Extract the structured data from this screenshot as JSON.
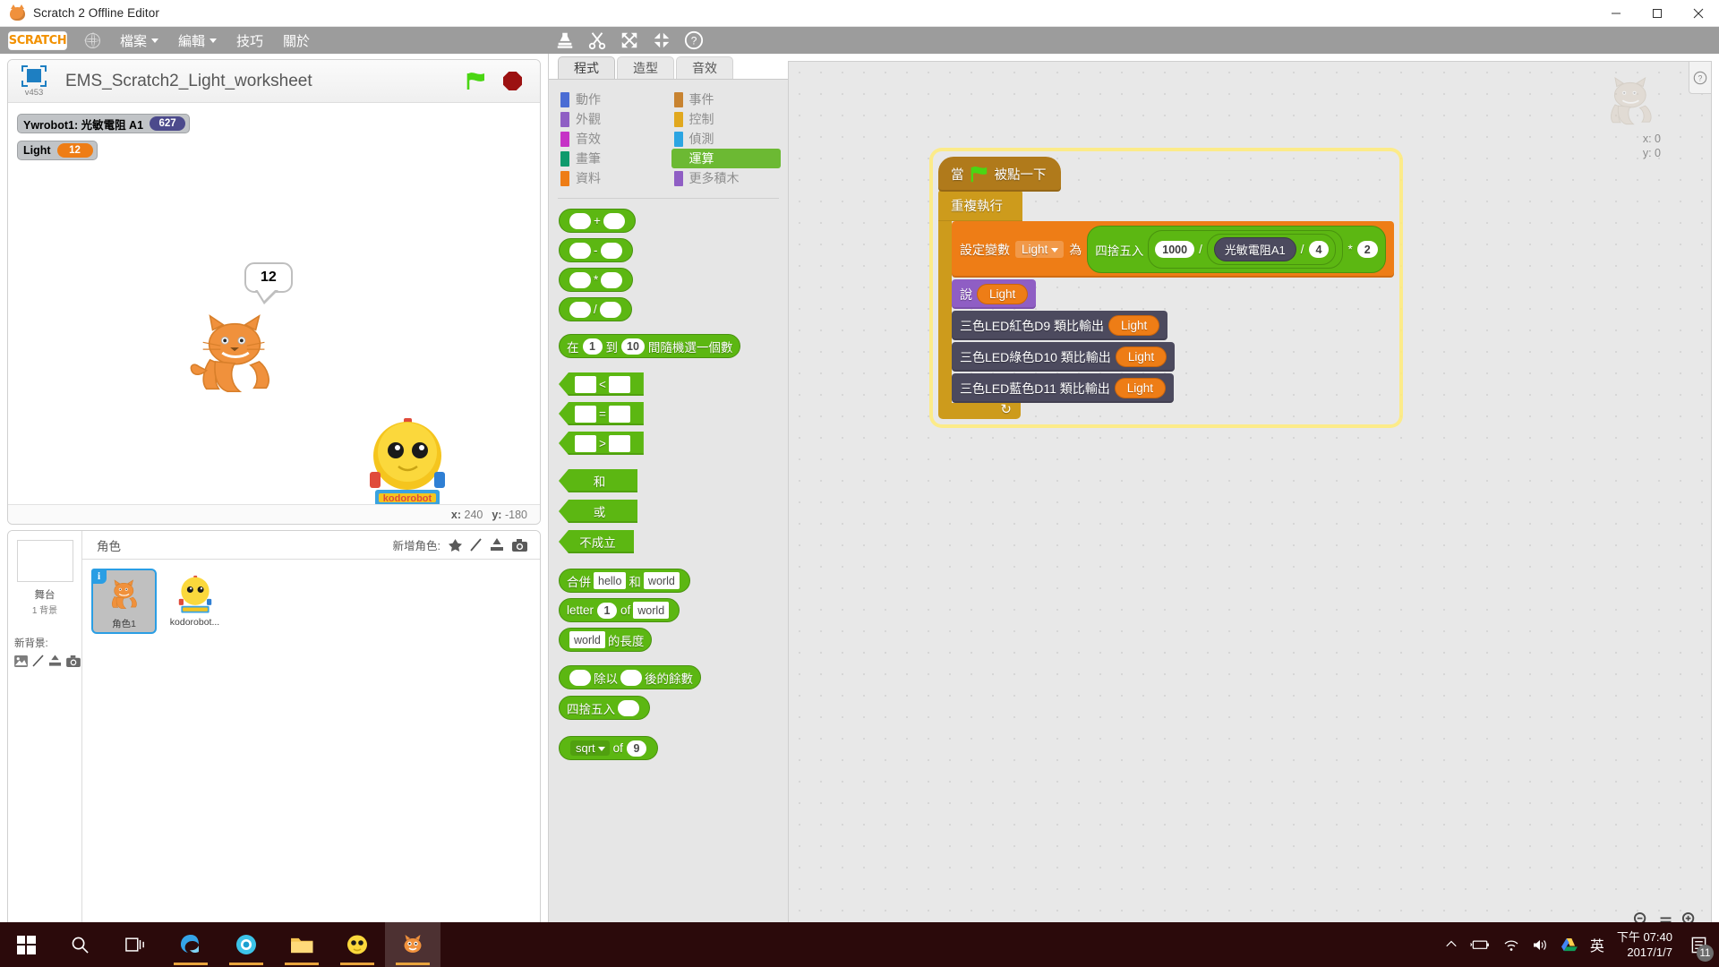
{
  "window": {
    "title": "Scratch 2 Offline Editor",
    "minimize": "minimize-icon",
    "maximize": "maximize-icon",
    "close": "close-icon"
  },
  "menubar": {
    "logo": "SCRATCH",
    "globe": "globe-icon",
    "items": [
      {
        "label": "檔案",
        "has_caret": true
      },
      {
        "label": "編輯",
        "has_caret": true
      },
      {
        "label": "技巧",
        "has_caret": false
      },
      {
        "label": "關於",
        "has_caret": false
      }
    ],
    "tools": [
      "stamp-icon",
      "scissors-icon",
      "grow-icon",
      "shrink-icon",
      "help-icon"
    ]
  },
  "stage": {
    "project_name": "EMS_Scratch2_Light_worksheet",
    "version_badge": "v453",
    "green_flag": "green-flag-icon",
    "stop": "stop-icon",
    "watchers": [
      {
        "label": "Ywrobot1: 光敏電阻 A1",
        "value": "627",
        "color": "#4c4a8c"
      },
      {
        "label": "Light",
        "value": "12",
        "color": "#ee7d16"
      }
    ],
    "speech_bubble": "12",
    "coords": {
      "x_label": "x:",
      "x_value": "240",
      "y_label": "y:",
      "y_value": "-180"
    }
  },
  "sprite_pane": {
    "stage_label": "舞台",
    "stage_sub": "1 背景",
    "new_backdrop_label": "新背景:",
    "new_backdrop_icons": [
      "library-icon",
      "paint-icon",
      "upload-icon",
      "camera-icon"
    ],
    "header_title": "角色",
    "add_sprite_label": "新增角色:",
    "add_sprite_icons": [
      "library-icon",
      "paint-icon",
      "upload-icon",
      "camera-icon"
    ],
    "sprites": [
      {
        "name": "角色1",
        "selected": true,
        "info_badge": "i"
      },
      {
        "name": "kodorobot...",
        "selected": false,
        "info_badge": ""
      }
    ]
  },
  "tabs": [
    {
      "label": "程式",
      "active": true
    },
    {
      "label": "造型",
      "active": false
    },
    {
      "label": "音效",
      "active": false
    }
  ],
  "categories_left": [
    {
      "label": "動作",
      "color": "#4a6cd4",
      "selected": false
    },
    {
      "label": "外觀",
      "color": "#8f5ec4",
      "selected": false
    },
    {
      "label": "音效",
      "color": "#c632c6",
      "selected": false
    },
    {
      "label": "畫筆",
      "color": "#0e9a6c",
      "selected": false
    },
    {
      "label": "資料",
      "color": "#ee7d16",
      "selected": false
    }
  ],
  "categories_right": [
    {
      "label": "事件",
      "color": "#c88330",
      "selected": false
    },
    {
      "label": "控制",
      "color": "#e1a81e",
      "selected": false
    },
    {
      "label": "偵測",
      "color": "#2ca5e2",
      "selected": false
    },
    {
      "label": "運算",
      "color": "#5cb712",
      "selected": true
    },
    {
      "label": "更多積木",
      "color": "#8f5ec4",
      "selected": false
    }
  ],
  "palette_blocks": {
    "arithmetic": [
      {
        "op": "+"
      },
      {
        "op": "-"
      },
      {
        "op": "*"
      },
      {
        "op": "/"
      }
    ],
    "random": {
      "prefix": "在",
      "from": "1",
      "mid": "到",
      "to": "10",
      "suffix": "間隨機選一個數"
    },
    "comparisons": [
      {
        "op": "<"
      },
      {
        "op": "="
      },
      {
        "op": ">"
      }
    ],
    "booleans": [
      {
        "label": "和"
      },
      {
        "label": "或"
      },
      {
        "label": "不成立"
      }
    ],
    "join": {
      "prefix": "合併",
      "a": "hello",
      "mid": "和",
      "b": "world"
    },
    "letter": {
      "prefix": "letter",
      "index": "1",
      "mid": "of",
      "text": "world"
    },
    "length": {
      "text": "world",
      "suffix": "的長度"
    },
    "mod": {
      "mid": "除以",
      "suffix": "後的餘數"
    },
    "round": {
      "label": "四捨五入"
    },
    "mathop": {
      "fn": "sqrt",
      "mid": "of",
      "num": "9"
    }
  },
  "script": {
    "hat": {
      "prefix": "當",
      "flag": "green-flag-icon",
      "suffix": "被點一下"
    },
    "forever": "重複執行",
    "set_var": {
      "prefix": "設定變數",
      "variable": "Light",
      "suffix": "為",
      "round_label": "四捨五入",
      "numerator": "1000",
      "div1": "/",
      "sensor": "光敏電阻A1",
      "div2": "/",
      "divisor": "4",
      "mul": "*",
      "factor": "2"
    },
    "say": {
      "label": "說",
      "value": "Light"
    },
    "led_blocks": [
      {
        "label": "三色LED紅色D9 類比輸出",
        "value": "Light"
      },
      {
        "label": "三色LED綠色D10 類比輸出",
        "value": "Light"
      },
      {
        "label": "三色LED藍色D11 類比輸出",
        "value": "Light"
      }
    ]
  },
  "script_area": {
    "ghost_x": "x: 0",
    "ghost_y": "y: 0",
    "help_icon": "question-icon",
    "zoom_out": "zoom-out-icon",
    "zoom_reset": "zoom-reset-icon",
    "zoom_in": "zoom-in-icon"
  },
  "taskbar": {
    "start": "windows-start-icon",
    "search": "search-icon",
    "taskview": "task-view-icon",
    "apps": [
      "edge-icon",
      "browser-icon",
      "file-explorer-icon",
      "robot-icon",
      "scratch-icon"
    ],
    "tray": [
      "chevron-up-icon",
      "battery-icon",
      "wifi-icon",
      "volume-icon",
      "drive-icon"
    ],
    "ime": "英",
    "time": "下午 07:40",
    "date": "2017/1/7",
    "notification_count": "11"
  }
}
